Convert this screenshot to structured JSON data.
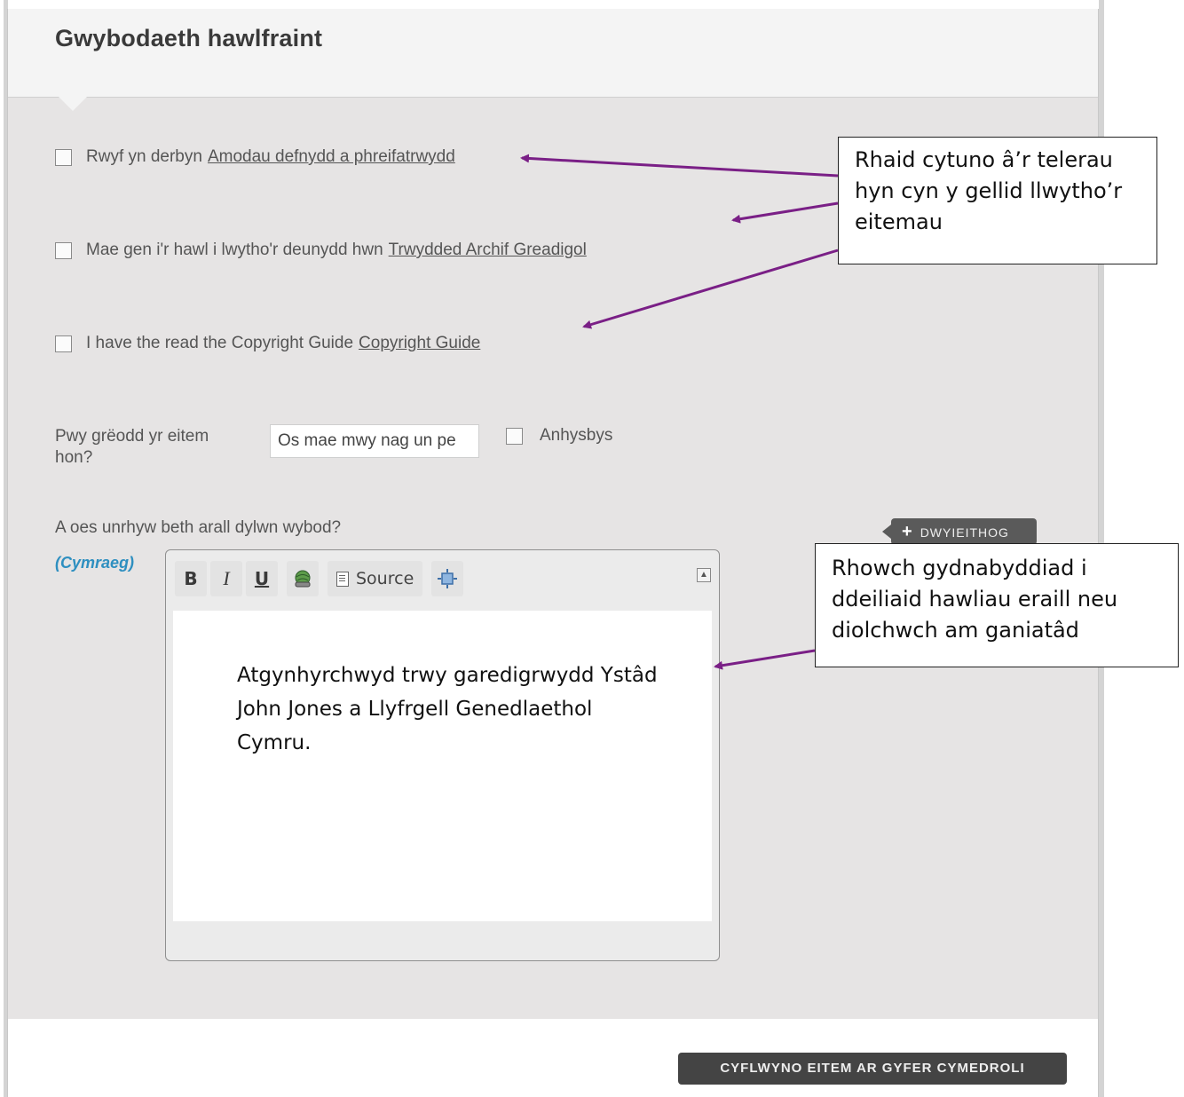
{
  "page": {
    "title": "Gwybodaeth hawlfraint"
  },
  "agreements": [
    {
      "text": "Rwyf yn derbyn",
      "link": "Amodau defnydd a phreifatrwydd"
    },
    {
      "text": "Mae gen i'r hawl i lwytho'r deunydd hwn",
      "link": "Trwydded Archif Greadigol"
    },
    {
      "text": "I have the read the Copyright Guide",
      "link": "Copyright Guide"
    }
  ],
  "creator": {
    "label": "Pwy grëodd yr eitem hon?",
    "input_value": "Os mae mwy nag un pe",
    "unknown_label": "Anhysbys"
  },
  "notes": {
    "question": "A oes unrhyw beth arall dylwn wybod?",
    "language_label": "(Cymraeg)",
    "bilingual_button": "DWYIEITHOG",
    "toolbar": {
      "bold": "B",
      "italic": "I",
      "underline": "U",
      "source": "Source"
    },
    "content": "Atgynhyrchwyd trwy garedigrwydd Ystâd John Jones a Llyfrgell Genedlaethol Cymru."
  },
  "submit_button": "CYFLWYNO EITEM AR GYFER CYMEDROLI",
  "callouts": {
    "terms": "Rhaid cytuno â’r telerau hyn cyn y gellid llwytho’r eitemau",
    "acknowledge": "Rhowch gydnabyddiad i ddeiliaid hawliau eraill neu diolchwch am ganiatâd"
  },
  "colors": {
    "arrow": "#7a1f86",
    "language_label": "#2e8fc0",
    "panel_bg": "#e6e4e4"
  }
}
